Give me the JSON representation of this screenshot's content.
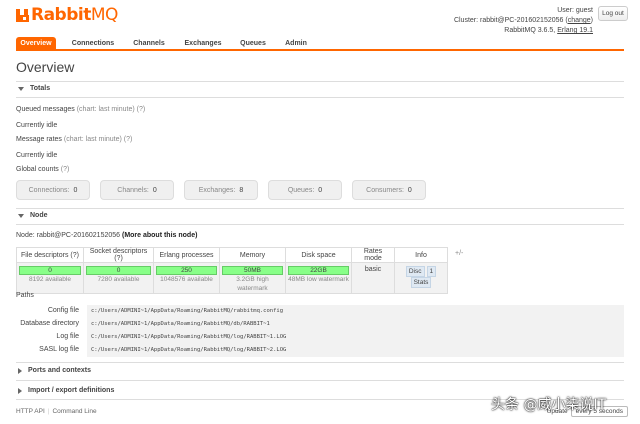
{
  "brand": {
    "name_prefix": "Rabbit",
    "name_suffix": "MQ",
    "color": "#ff6600"
  },
  "user": {
    "user_label": "User:",
    "user_name": "guest",
    "cluster_label": "Cluster:",
    "cluster_name": "rabbit@PC-201602152056",
    "change_label": "change",
    "version": "RabbitMQ 3.6.5,",
    "erlang": "Erlang 19.1",
    "logout_label": "Log out"
  },
  "tabs": [
    "Overview",
    "Connections",
    "Channels",
    "Exchanges",
    "Queues",
    "Admin"
  ],
  "page_title": "Overview",
  "totals": {
    "heading": "Totals",
    "queued_label": "Queued messages",
    "queued_chart": "(chart: last minute)",
    "queued_help": "(?)",
    "queued_status": "Currently idle",
    "rates_label": "Message rates",
    "rates_chart": "(chart: last minute)",
    "rates_help": "(?)",
    "rates_status": "Currently idle",
    "global_label": "Global counts",
    "global_help": "(?)"
  },
  "counters": [
    {
      "label": "Connections:",
      "value": "0"
    },
    {
      "label": "Channels:",
      "value": "0"
    },
    {
      "label": "Exchanges:",
      "value": "8"
    },
    {
      "label": "Queues:",
      "value": "0"
    },
    {
      "label": "Consumers:",
      "value": "0"
    }
  ],
  "node": {
    "heading": "Node",
    "node_label": "Node:",
    "node_name": "rabbit@PC-201602152056",
    "more_link": "(More about this node)",
    "headers": [
      "File descriptors (?)",
      "Socket descriptors (?)",
      "Erlang processes",
      "Memory",
      "Disk space",
      "Rates mode",
      "Info"
    ],
    "fd_value": "0",
    "fd_sub": "8192 available",
    "sock_value": "0",
    "sock_sub": "7280 available",
    "proc_value": "250",
    "proc_sub": "1048576 available",
    "mem_value": "50MB",
    "mem_sub": "3.2GB high watermark",
    "disk_value": "22GB",
    "disk_sub": "48MB low watermark",
    "rates_mode": "basic",
    "info_badges": [
      "Disc",
      "1",
      "Stats"
    ],
    "plus_minus": "+/-",
    "bar_color": "#88ff88"
  },
  "paths": {
    "label": "Paths",
    "rows": [
      {
        "key": "Config file",
        "value": "c:/Users/ADMINI~1/AppData/Roaming/RabbitMQ/rabbitmq.config"
      },
      {
        "key": "Database directory",
        "value": "c:/Users/ADMINI~1/AppData/Roaming/RabbitMQ/db/RABBIT~1"
      },
      {
        "key": "Log file",
        "value": "C:/Users/ADMINI~1/AppData/Roaming/RabbitMQ/log/RABBIT~1.LOG"
      },
      {
        "key": "SASL log file",
        "value": "C:/Users/ADMINI~1/AppData/Roaming/RabbitMQ/log/RABBIT~2.LOG"
      }
    ]
  },
  "collapsed_sections": [
    "Ports and contexts",
    "Import / export definitions"
  ],
  "footer": {
    "http_api": "HTTP API",
    "command_line": "Command Line",
    "update_label": "Update",
    "update_value": "every 5 seconds"
  },
  "watermark": "头条 @威小柒说IT"
}
